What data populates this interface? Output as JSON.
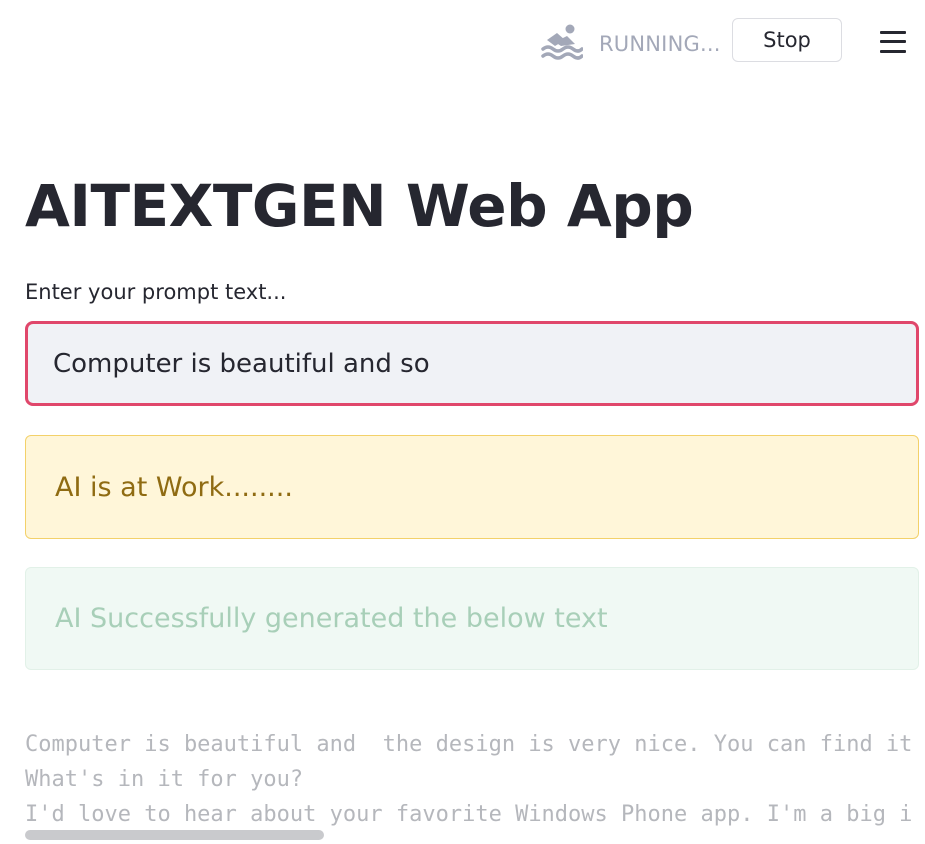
{
  "status": {
    "icon": "swimmer-icon",
    "text": "RUNNING..."
  },
  "toolbar": {
    "stop_label": "Stop",
    "menu_icon": "hamburger-menu-icon"
  },
  "main": {
    "title": "AITEXTGEN Web App",
    "prompt_label": "Enter your prompt text...",
    "prompt_value": "Computer is beautiful and so",
    "warning_text": "AI is at Work........",
    "success_text": "AI Successfully generated the below text",
    "output_lines": [
      "Computer is beautiful and  the design is very nice. You can find it",
      "What's in it for you?",
      "I'd love to hear about your favorite Windows Phone app. I'm a big i"
    ]
  },
  "colors": {
    "input_focus_border": "#e0476b",
    "warning_bg": "#fff6d9",
    "success_bg": "#f0f9f4"
  }
}
